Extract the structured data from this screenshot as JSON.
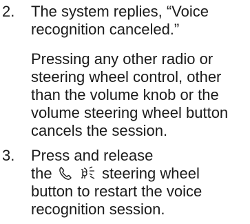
{
  "steps": [
    {
      "number": "2.",
      "lines": [
        "The system replies, “Voice",
        "recognition canceled.”"
      ],
      "note_lines": [
        "Pressing any other radio or",
        "steering wheel control, other",
        "than the volume knob or the",
        "volume steering wheel button",
        "cancels the session."
      ]
    },
    {
      "number": "3.",
      "lines_before_icons": [
        "Press and release"
      ],
      "icon_line_prefix": "the",
      "icon_line_suffix": "steering wheel",
      "icons": [
        "phone-icon",
        "voice-recognition-icon"
      ],
      "lines_after_icons": [
        "button to restart the voice",
        "recognition session."
      ]
    }
  ]
}
